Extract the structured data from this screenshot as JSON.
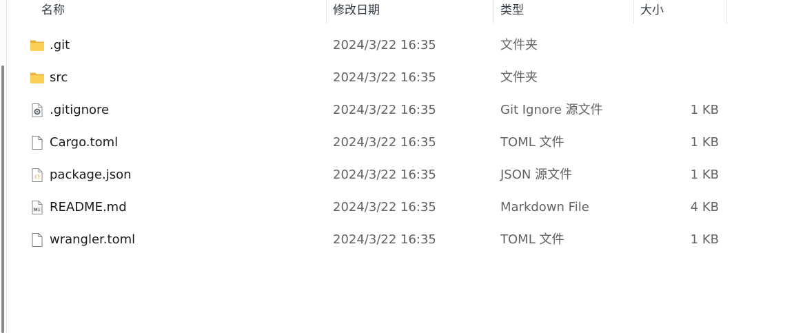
{
  "columns": {
    "name": "名称",
    "date": "修改日期",
    "type": "类型",
    "size": "大小"
  },
  "files": [
    {
      "name": ".git",
      "date": "2024/3/22 16:35",
      "type": "文件夹",
      "size": "",
      "icon": "folder-icon"
    },
    {
      "name": "src",
      "date": "2024/3/22 16:35",
      "type": "文件夹",
      "size": "",
      "icon": "folder-icon"
    },
    {
      "name": ".gitignore",
      "date": "2024/3/22 16:35",
      "type": "Git Ignore 源文件",
      "size": "1 KB",
      "icon": "settings-file-icon"
    },
    {
      "name": "Cargo.toml",
      "date": "2024/3/22 16:35",
      "type": "TOML 文件",
      "size": "1 KB",
      "icon": "blank-file-icon"
    },
    {
      "name": "package.json",
      "date": "2024/3/22 16:35",
      "type": "JSON 源文件",
      "size": "1 KB",
      "icon": "json-file-icon"
    },
    {
      "name": "README.md",
      "date": "2024/3/22 16:35",
      "type": "Markdown File",
      "size": "4 KB",
      "icon": "markdown-file-icon"
    },
    {
      "name": "wrangler.toml",
      "date": "2024/3/22 16:35",
      "type": "TOML 文件",
      "size": "1 KB",
      "icon": "blank-file-icon"
    }
  ]
}
